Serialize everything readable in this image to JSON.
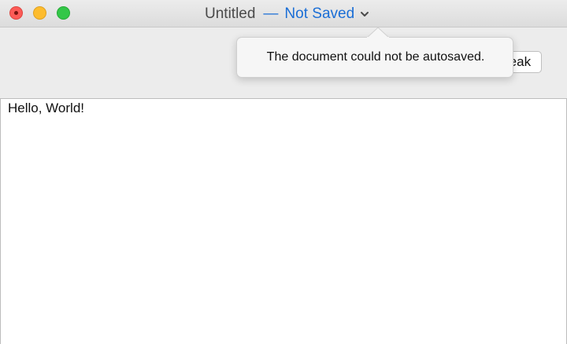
{
  "window": {
    "title": {
      "document_name": "Untitled",
      "separator": "—",
      "status": "Not Saved"
    },
    "traffic_lights": {
      "close": "close-icon",
      "minimize": "minimize-icon",
      "zoom": "zoom-icon"
    }
  },
  "toolbar": {
    "speak_button_label": "Speak"
  },
  "popover": {
    "message": "The document could not be autosaved."
  },
  "editor": {
    "content": "Hello, World!"
  },
  "colors": {
    "title_accent": "#1a6ed6",
    "close": "#fc5b57",
    "minimize": "#fdbc2e",
    "zoom": "#33c748"
  }
}
